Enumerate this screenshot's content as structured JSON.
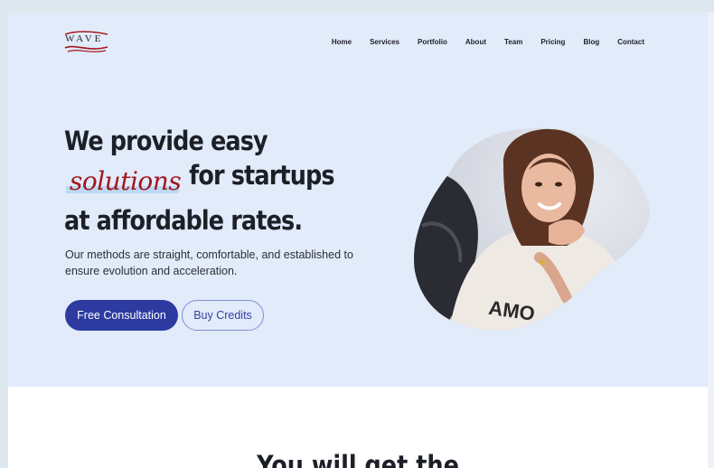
{
  "brand": {
    "logo_text": "WAVE"
  },
  "nav": {
    "items": [
      "Home",
      "Services",
      "Portfolio",
      "About",
      "Team",
      "Pricing",
      "Blog",
      "Contact"
    ]
  },
  "hero": {
    "line1": "We provide easy",
    "highlight": "solutions",
    "line2": "for startups",
    "line3": "at affordable rates.",
    "description": "Our methods are straight, comfortable, and established to ensure evolution and acceleration.",
    "primary_button": "Free Consultation",
    "secondary_button": "Buy Credits"
  },
  "next_section": {
    "title": "You will get the"
  },
  "colors": {
    "hero_bg": "#e1ebfa",
    "primary": "#2d3aa0",
    "accent_script": "#a2161e",
    "highlight": "#bcd8f3"
  }
}
